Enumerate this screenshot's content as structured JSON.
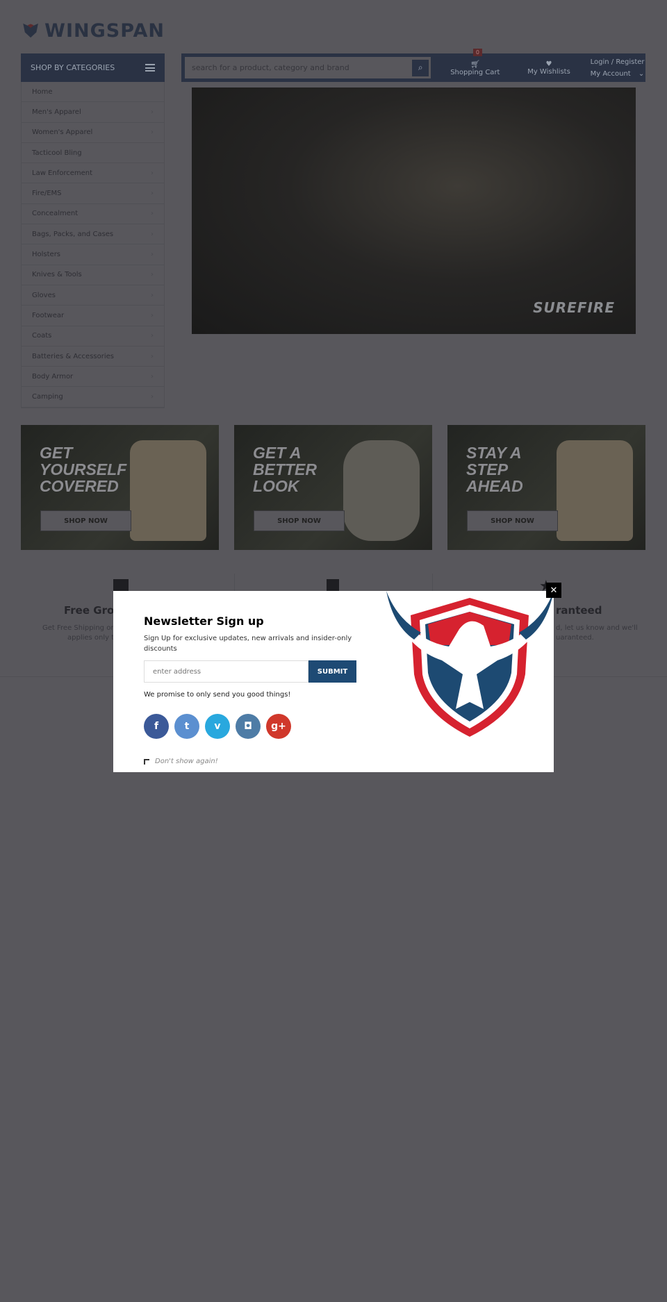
{
  "logo": {
    "text": "WINGSPAN"
  },
  "sidebar": {
    "title": "SHOP BY CATEGORIES",
    "items": [
      {
        "label": "Home",
        "sub": false
      },
      {
        "label": "Men's Apparel",
        "sub": true
      },
      {
        "label": "Women's Apparel",
        "sub": true
      },
      {
        "label": "Tacticool Bling",
        "sub": false
      },
      {
        "label": "Law Enforcement",
        "sub": true
      },
      {
        "label": "Fire/EMS",
        "sub": true
      },
      {
        "label": "Concealment",
        "sub": true
      },
      {
        "label": "Bags, Packs, and Cases",
        "sub": true
      },
      {
        "label": "Holsters",
        "sub": true
      },
      {
        "label": "Knives & Tools",
        "sub": true
      },
      {
        "label": "Gloves",
        "sub": true
      },
      {
        "label": "Footwear",
        "sub": true
      },
      {
        "label": "Coats",
        "sub": true
      },
      {
        "label": "Batteries & Accessories",
        "sub": true
      },
      {
        "label": "Body Armor",
        "sub": true
      },
      {
        "label": "Camping",
        "sub": true
      }
    ]
  },
  "header": {
    "search_placeholder": "search for a product, category and brand",
    "cart_label": "Shopping Cart",
    "cart_count": "0",
    "wishlist_label": "My Wishlists",
    "login_label": "Login / Register",
    "account_label": "My Account"
  },
  "hero": {
    "brand": "SUREFIRE"
  },
  "banners": [
    {
      "title": "GET YOURSELF COVERED",
      "button": "SHOP NOW"
    },
    {
      "title": "GET A BETTER LOOK",
      "button": "SHOP NOW"
    },
    {
      "title": "STAY A STEP AHEAD",
      "button": "SHOP NOW"
    }
  ],
  "features": {
    "left_title": "Free Grou",
    "left_desc1": "Get Free Shipping on",
    "left_desc2": "applies only t",
    "right_title": "ranteed",
    "right_desc1": "d, let us know and we'll",
    "right_desc2": "uaranteed."
  },
  "popup": {
    "title": "Newsletter Sign up",
    "subtitle": "Sign Up for exclusive updates, new arrivals and insider-only discounts",
    "email_placeholder": "enter address",
    "submit": "SUBMIT",
    "promise": "We promise to only send you good things!",
    "dont_show": "Don't show again!",
    "close": "✕",
    "social": [
      {
        "name": "facebook",
        "glyph": "f",
        "color": "#3b5998"
      },
      {
        "name": "twitter",
        "glyph": "t",
        "color": "#5b8fd0"
      },
      {
        "name": "vimeo",
        "glyph": "v",
        "color": "#29a8de"
      },
      {
        "name": "instagram",
        "glyph": "◘",
        "color": "#4e7ca6"
      },
      {
        "name": "google-plus",
        "glyph": "g+",
        "color": "#d0382b"
      }
    ]
  },
  "colors": {
    "brand": "#1e4a74",
    "accent_red": "#d6222f"
  }
}
